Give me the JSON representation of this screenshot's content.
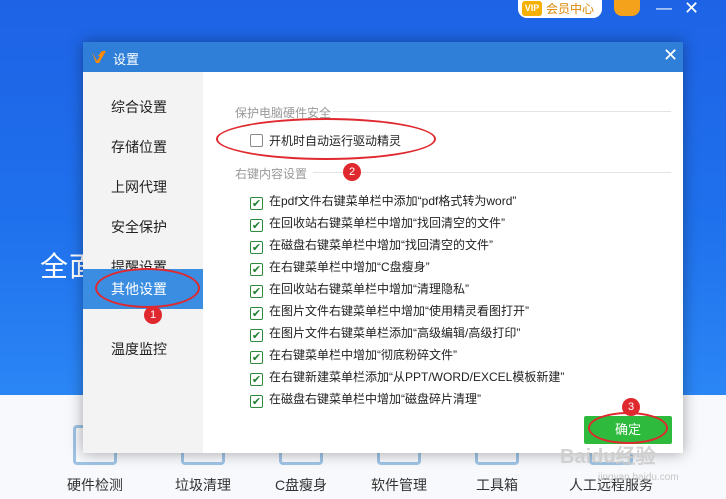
{
  "background": {
    "vip_label": "会员中心",
    "vip_mark": "VIP",
    "hero_text": "全面",
    "tools": [
      {
        "label": "硬件检测"
      },
      {
        "label": "垃圾清理"
      },
      {
        "label": "C盘瘦身"
      },
      {
        "label": "软件管理"
      },
      {
        "label": "工具箱"
      },
      {
        "label": "人工远程服务"
      }
    ]
  },
  "dialog": {
    "title": "设置",
    "sidebar": {
      "items": [
        {
          "label": "综合设置"
        },
        {
          "label": "存储位置"
        },
        {
          "label": "上网代理"
        },
        {
          "label": "安全保护"
        },
        {
          "label": "提醒设置"
        },
        {
          "label": "其他设置",
          "active": true
        },
        {
          "label": "温度监控"
        }
      ]
    },
    "section1": {
      "title": "保护电脑硬件安全",
      "options": [
        {
          "label": "开机时自动运行驱动精灵",
          "checked": false
        }
      ]
    },
    "section2": {
      "title": "右键内容设置",
      "options": [
        {
          "label": "在pdf文件右键菜单栏中添加“pdf格式转为word”",
          "checked": true
        },
        {
          "label": "在回收站右键菜单栏中增加“找回清空的文件”",
          "checked": true
        },
        {
          "label": "在磁盘右键菜单栏中增加“找回清空的文件”",
          "checked": true
        },
        {
          "label": "在右键菜单栏中增加“C盘瘦身”",
          "checked": true
        },
        {
          "label": "在回收站右键菜单栏中增加“清理隐私”",
          "checked": true
        },
        {
          "label": "在图片文件右键菜单栏中增加“使用精灵看图打开”",
          "checked": true
        },
        {
          "label": "在图片文件右键菜单栏添加“高级编辑/高级打印”",
          "checked": true
        },
        {
          "label": "在右键菜单栏中增加“彻底粉碎文件”",
          "checked": true
        },
        {
          "label": "在右键新建菜单栏添加“从PPT/WORD/EXCEL模板新建”",
          "checked": true
        },
        {
          "label": "在磁盘右键菜单栏中增加“磁盘碎片清理”",
          "checked": true
        }
      ]
    },
    "ok_label": "确定"
  },
  "annotations": {
    "markers": [
      "1",
      "2",
      "3"
    ],
    "color": "#e0292f"
  },
  "watermark": {
    "text": "Baidu经验",
    "url": "jingyan.baidu.com"
  },
  "colors": {
    "titlebar": "#2f7fd9",
    "sidebar_active": "#3a8de0",
    "ok_button": "#2ebb3d",
    "background_blue": "#1f70ec"
  }
}
